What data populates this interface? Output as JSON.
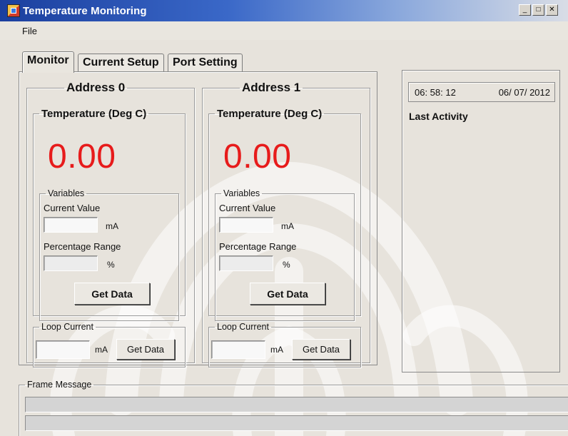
{
  "window": {
    "title": "Temperature Monitoring",
    "controls": {
      "minimize": "_",
      "maximize": "□",
      "close": "✕"
    }
  },
  "menu": {
    "file": "File"
  },
  "tabs": [
    {
      "label": "Monitor",
      "active": true
    },
    {
      "label": "Current Setup",
      "active": false
    },
    {
      "label": "Port Setting",
      "active": false
    }
  ],
  "addresses": [
    {
      "title": "Address 0",
      "temperature_title": "Temperature (Deg C)",
      "reading": "0.00",
      "variables_title": "Variables",
      "current_value_label": "Current Value",
      "current_value": "",
      "current_unit": "mA",
      "percentage_label": "Percentage Range",
      "percentage_value": "",
      "percentage_unit": "%",
      "get_data_label": "Get Data",
      "loop_title": "Loop Current",
      "loop_value": "",
      "loop_unit": "mA",
      "loop_get_data_label": "Get Data"
    },
    {
      "title": "Address 1",
      "temperature_title": "Temperature (Deg C)",
      "reading": "0.00",
      "variables_title": "Variables",
      "current_value_label": "Current Value",
      "current_value": "",
      "current_unit": "mA",
      "percentage_label": "Percentage Range",
      "percentage_value": "",
      "percentage_unit": "%",
      "get_data_label": "Get Data",
      "loop_title": "Loop Current",
      "loop_value": "",
      "loop_unit": "mA",
      "loop_get_data_label": "Get Data"
    }
  ],
  "status": {
    "time": "06: 58: 12",
    "date": "06/ 07/ 2012",
    "last_activity_label": "Last Activity"
  },
  "frame_message": {
    "title": "Frame Message",
    "line1": "",
    "line2": ""
  },
  "colors": {
    "reading": "#e71b1b",
    "titlebar": "#1b3f9e"
  }
}
